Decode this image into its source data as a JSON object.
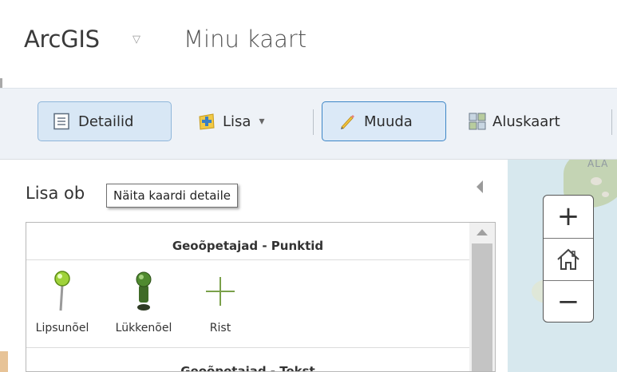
{
  "header": {
    "app_name": "ArcGIS",
    "app_caret": "▽",
    "map_title": "Minu kaart"
  },
  "toolbar": {
    "details_label": "Detailid",
    "add_label": "Lisa",
    "add_caret": "▾",
    "edit_label": "Muuda",
    "basemap_label": "Aluskaart"
  },
  "panel": {
    "title": "Lisa ob",
    "tooltip": "Näita kaardi detaile",
    "groups": [
      {
        "title": "Geoõpetajad - Punktid",
        "symbols": [
          {
            "label": "Lipsunõel",
            "icon": "pushpin-green-icon"
          },
          {
            "label": "Lükkenõel",
            "icon": "thumbtack-green-icon"
          },
          {
            "label": "Rist",
            "icon": "cross-icon"
          }
        ]
      },
      {
        "title": "Geoõpetajad - Tekst"
      }
    ]
  },
  "map": {
    "label_fragment": "ALA",
    "zoom_in": "+",
    "zoom_out": "−"
  },
  "colors": {
    "toolbar_bg": "#eef2f7",
    "active_btn_bg": "#d8e7f5",
    "active_btn_border": "#3d86c6",
    "map_water": "#d7e8ee"
  }
}
